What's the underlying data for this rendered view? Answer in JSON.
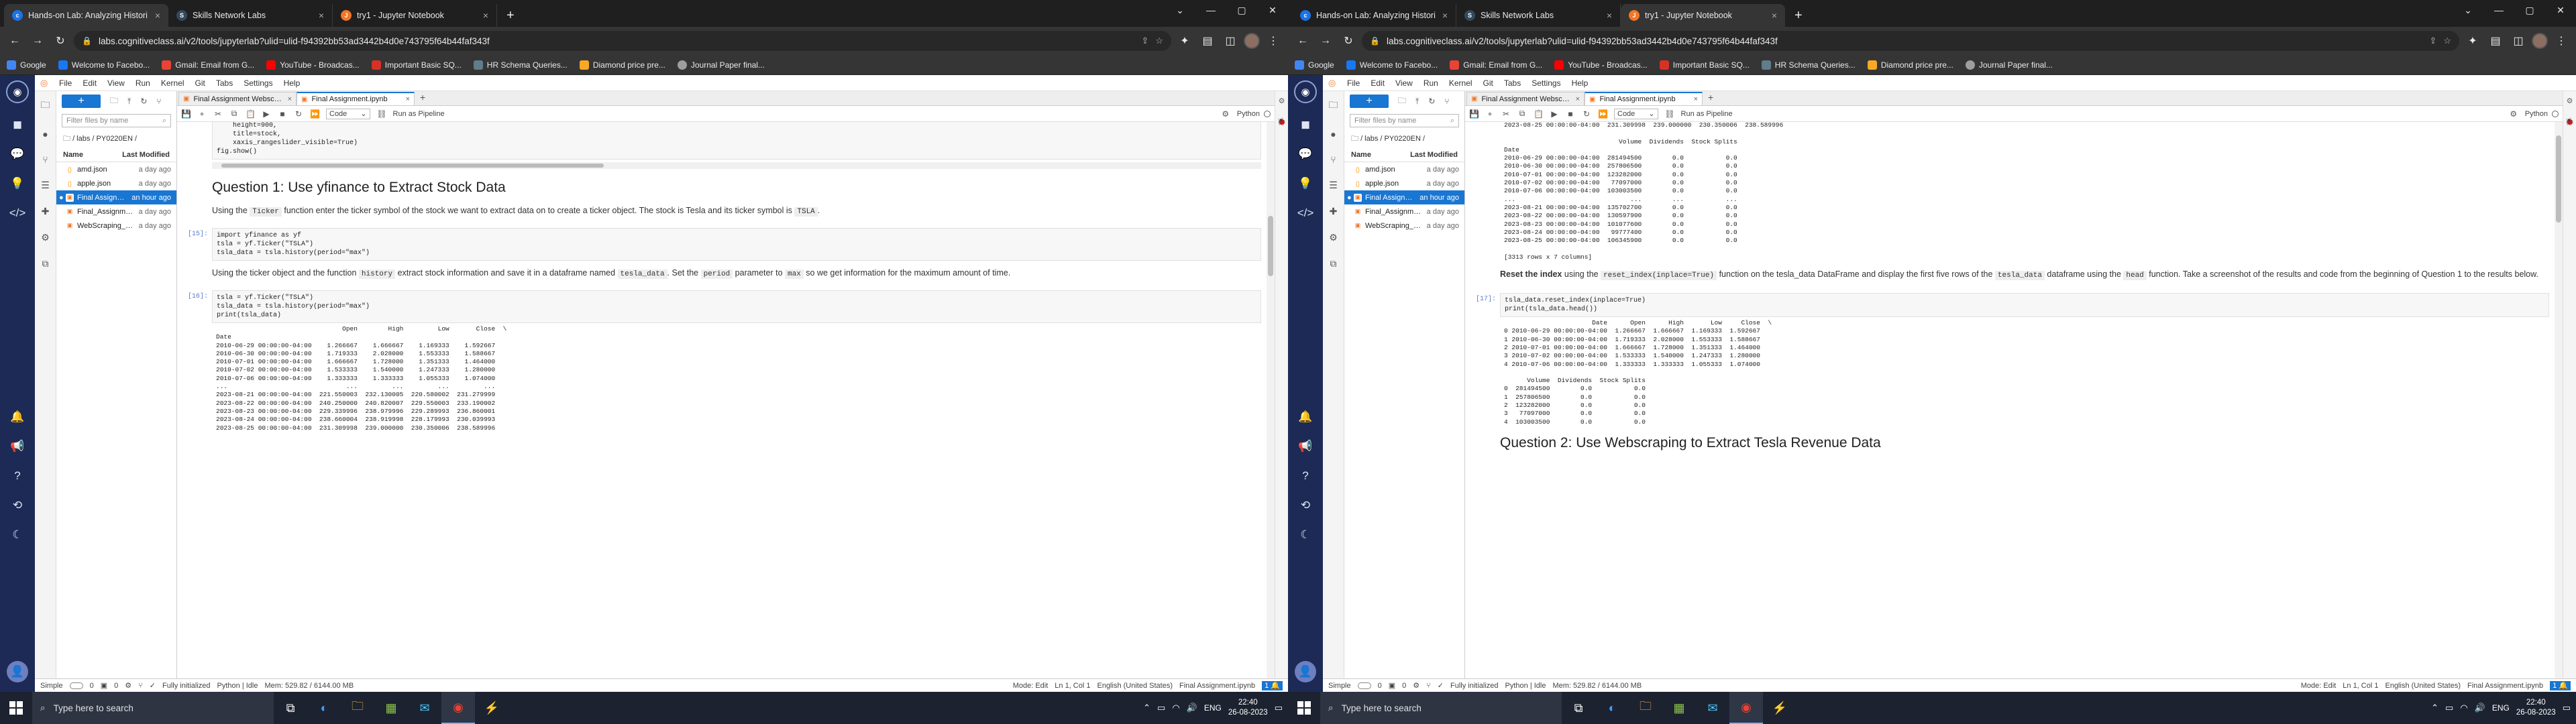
{
  "left": {
    "browser": {
      "tabs": [
        {
          "title": "Hands-on Lab: Analyzing Histori",
          "icon": "cognitiveclass-icon",
          "active": true
        },
        {
          "title": "Skills Network Labs",
          "icon": "skills-network-icon",
          "active": false
        },
        {
          "title": "try1 - Jupyter Notebook",
          "icon": "jupyter-icon",
          "active": false
        }
      ],
      "url": "labs.cognitiveclass.ai/v2/tools/jupyterlab?ulid=ulid-f94392bb53ad3442b4d0e743795f64b44faf343f"
    },
    "notebook_tabs": [
      "Final Assignment Webscrapi",
      "Final Assignment.ipynb"
    ],
    "cells": [
      {
        "type": "code-tail",
        "lines": [
          "    height=900,",
          "    title=stock,",
          "    xaxis_rangeslider_visible=True)",
          "fig.show()"
        ]
      },
      {
        "type": "heading",
        "text": "Question 1: Use yfinance to Extract Stock Data"
      },
      {
        "type": "md",
        "parts": [
          "Using the ",
          "Ticker",
          " function enter the ticker symbol of the stock we want to extract data on to create a ticker object. The stock is Tesla and its ticker symbol is ",
          "TSLA",
          "."
        ]
      },
      {
        "type": "code",
        "prompt": "[15]:",
        "lines": [
          "import yfinance as yf",
          "tsla = yf.Ticker(\"TSLA\")",
          "tsla_data = tsla.history(period=\"max\")"
        ]
      },
      {
        "type": "md",
        "parts": [
          "Using the ticker object and the function ",
          "history",
          " extract stock information and save it in a dataframe named ",
          "tesla_data",
          ". Set the ",
          "period",
          " parameter to ",
          "max",
          " so we get information for the maximum amount of time."
        ]
      },
      {
        "type": "code",
        "prompt": "[16]:",
        "lines": [
          "tsla = yf.Ticker(\"TSLA\")",
          "tsla_data = tsla.history(period=\"max\")",
          "print(tsla_data)"
        ]
      },
      {
        "type": "output",
        "lines": [
          "                                 Open        High         Low       Close  \\",
          "Date",
          "2010-06-29 00:00:00-04:00    1.266667    1.666667    1.169333    1.592667",
          "2010-06-30 00:00:00-04:00    1.719333    2.028000    1.553333    1.588667",
          "2010-07-01 00:00:00-04:00    1.666667    1.728000    1.351333    1.464000",
          "2010-07-02 00:00:00-04:00    1.533333    1.540000    1.247333    1.280000",
          "2010-07-06 00:00:00-04:00    1.333333    1.333333    1.055333    1.074000",
          "...                               ...         ...         ...         ...",
          "2023-08-21 00:00:00-04:00  221.550003  232.130005  220.580002  231.279999",
          "2023-08-22 00:00:00-04:00  240.250000  240.820007  229.550003  233.190002",
          "2023-08-23 00:00:00-04:00  229.339996  238.979996  229.289993  236.860001",
          "2023-08-24 00:00:00-04:00  238.660004  238.919998  228.179993  230.039993",
          "2023-08-25 00:00:00-04:00  231.309998  239.000000  230.350006  238.589996"
        ]
      }
    ],
    "status": {
      "mode": "Simple",
      "num1": "0",
      "num2": "0",
      "kernel_status": "Fully initialized",
      "kernel": "Python | Idle",
      "mem": "Mem: 529.82 / 6144.00 MB",
      "edit_mode": "Mode: Edit",
      "pos": "Ln 1, Col 1",
      "lang": "English (United States)",
      "file": "Final Assignment.ipynb",
      "bell_count": "1"
    }
  },
  "right": {
    "browser": {
      "tabs": [
        {
          "title": "Hands-on Lab: Analyzing Histori",
          "icon": "cognitiveclass-icon",
          "active": false
        },
        {
          "title": "Skills Network Labs",
          "icon": "skills-network-icon",
          "active": false
        },
        {
          "title": "try1 - Jupyter Notebook",
          "icon": "jupyter-icon",
          "active": true
        }
      ],
      "url": "labs.cognitiveclass.ai/v2/tools/jupyterlab?ulid=ulid-f94392bb53ad3442b4d0e743795f64b44faf343f"
    },
    "notebook_tabs": [
      "Final Assignment Webscrapi",
      "Final Assignment.ipynb"
    ],
    "cells": [
      {
        "type": "output",
        "lines": [
          "2023-08-25 00:00:00-04:00  231.309998  239.000000  230.350006  238.589996",
          "",
          "                              Volume  Dividends  Stock Splits",
          "Date",
          "2010-06-29 00:00:00-04:00  281494500        0.0           0.0",
          "2010-06-30 00:00:00-04:00  257806500        0.0           0.0",
          "2010-07-01 00:00:00-04:00  123282000        0.0           0.0",
          "2010-07-02 00:00:00-04:00   77097000        0.0           0.0",
          "2010-07-06 00:00:00-04:00  103003500        0.0           0.0",
          "...                              ...        ...           ...",
          "2023-08-21 00:00:00-04:00  135702700        0.0           0.0",
          "2023-08-22 00:00:00-04:00  130597900        0.0           0.0",
          "2023-08-23 00:00:00-04:00  101077600        0.0           0.0",
          "2023-08-24 00:00:00-04:00   99777400        0.0           0.0",
          "2023-08-25 00:00:00-04:00  106345900        0.0           0.0",
          "",
          "[3313 rows x 7 columns]"
        ]
      },
      {
        "type": "md",
        "parts": [
          "Reset the index",
          " using the ",
          "reset_index(inplace=True)",
          " function on the tesla_data DataFrame and display the first five rows of the ",
          "tesla_data",
          " dataframe using the ",
          "head",
          " function. Take a screenshot of the results and code from the beginning of Question 1 to the results below."
        ]
      },
      {
        "type": "code",
        "prompt": "[17]:",
        "lines": [
          "tsla_data.reset_index(inplace=True)",
          "print(tsla_data.head())"
        ]
      },
      {
        "type": "output",
        "lines": [
          "                       Date      Open      High       Low     Close  \\",
          "0 2010-06-29 00:00:00-04:00  1.266667  1.666667  1.169333  1.592667",
          "1 2010-06-30 00:00:00-04:00  1.719333  2.028000  1.553333  1.588667",
          "2 2010-07-01 00:00:00-04:00  1.666667  1.728000  1.351333  1.464000",
          "3 2010-07-02 00:00:00-04:00  1.533333  1.540000  1.247333  1.280000",
          "4 2010-07-06 00:00:00-04:00  1.333333  1.333333  1.055333  1.074000",
          "",
          "      Volume  Dividends  Stock Splits",
          "0  281494500        0.0           0.0",
          "1  257806500        0.0           0.0",
          "2  123282000        0.0           0.0",
          "3   77097000        0.0           0.0",
          "4  103003500        0.0           0.0"
        ]
      },
      {
        "type": "heading",
        "text": "Question 2: Use Webscraping to Extract Tesla Revenue Data"
      }
    ],
    "status": {
      "mode": "Simple",
      "num1": "0",
      "num2": "0",
      "kernel_status": "Fully initialized",
      "kernel": "Python | Idle",
      "mem": "Mem: 529.82 / 6144.00 MB",
      "edit_mode": "Mode: Edit",
      "pos": "Ln 1, Col 1",
      "lang": "English (United States)",
      "file": "Final Assignment.ipynb",
      "bell_count": "1"
    }
  },
  "bookmarks": [
    {
      "label": "Google",
      "color": "#4285f4"
    },
    {
      "label": "Welcome to Facebo...",
      "color": "#1877f2"
    },
    {
      "label": "Gmail: Email from G...",
      "color": "#ea4335"
    },
    {
      "label": "YouTube - Broadcas...",
      "color": "#ff0000"
    },
    {
      "label": "Important Basic SQ...",
      "color": "#d93025"
    },
    {
      "label": "HR Schema Queries...",
      "color": "#607d8b"
    },
    {
      "label": "Diamond price pre...",
      "color": "#f9a825"
    },
    {
      "label": "Journal Paper final...",
      "color": "#9e9e9e"
    }
  ],
  "jupyter_menu": [
    "File",
    "Edit",
    "View",
    "Run",
    "Kernel",
    "Git",
    "Tabs",
    "Settings",
    "Help"
  ],
  "file_browser": {
    "filter_placeholder": "Filter files by name",
    "path": "/ labs / PY0220EN /",
    "col_name": "Name",
    "col_modified": "Last Modified",
    "files": [
      {
        "name": "amd.json",
        "modified": "a day ago",
        "type": "json"
      },
      {
        "name": "apple.json",
        "modified": "a day ago",
        "type": "json"
      },
      {
        "name": "Final Assignmen...",
        "modified": "an hour ago",
        "type": "notebook",
        "selected": true,
        "running": true
      },
      {
        "name": "Final_Assignme...",
        "modified": "a day ago",
        "type": "notebook"
      },
      {
        "name": "WebScraping_R...",
        "modified": "a day ago",
        "type": "notebook"
      }
    ]
  },
  "notebook_toolbar": {
    "cell_type": "Code",
    "run_pipeline": "Run as Pipeline",
    "kernel": "Python"
  },
  "taskbar": {
    "search_placeholder": "Type here to search",
    "language": "ENG",
    "time": "22:40",
    "date": "26-08-2023"
  }
}
